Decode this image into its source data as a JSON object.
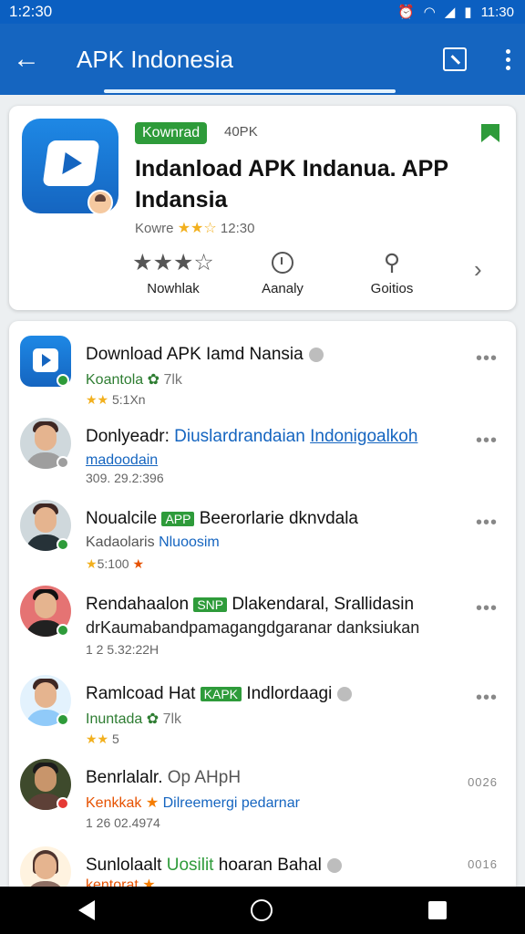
{
  "status": {
    "time_left": "1:2:30",
    "time_right": "11:30"
  },
  "appbar": {
    "title": "APK Indonesia"
  },
  "hero": {
    "badge": "Kownrad",
    "badge_sub": "40PK",
    "title": "Indanload APK Indanua. APP Indansia",
    "meta_label": "Kowre",
    "meta_stars": "★★☆",
    "meta_count": "12:30",
    "stats": [
      {
        "top": "★★★☆",
        "label": "Nowhlak"
      },
      {
        "top": "",
        "label": "Aanaly"
      },
      {
        "top": "⚲",
        "label": "Goitios"
      }
    ]
  },
  "list": [
    {
      "title": "Download APK Iamd Nansia",
      "sub": "Koantola",
      "sub2": "7lk",
      "meta_stars": "★★",
      "meta": "5:1Xn"
    },
    {
      "title": "Donlyeadr:",
      "title_link": "Diuslardrandaian",
      "title_link2": "Indonigoalkoh",
      "sub": "madoodain",
      "meta": "309. 29.2:396"
    },
    {
      "title": "Noualcile",
      "tag": "APP",
      "title_rest": "Beerorlarie dknvdala",
      "sub": "Kadaolaris",
      "sub_blue": "Nluoosim",
      "meta_stars": "★",
      "meta": "5:100",
      "meta_extra": "★"
    },
    {
      "title": "Rendahaalon",
      "tag": "SNP",
      "title_rest": "Dlakendaral, Srallidasin",
      "sub": "drKaumabandpamagangdgaranar danksiukan",
      "meta": "1 2 5.32:22H"
    },
    {
      "title": "Ramlcoad Hat",
      "tag": "KAPK",
      "title_rest": "Indlordaagi",
      "sub": "Inuntada",
      "sub2": "7lk",
      "meta_stars": "★★",
      "meta": "5"
    },
    {
      "title": "Benrlalalr.",
      "title_rest": "Op AHpH",
      "sub_orange": "Kenkkak",
      "sub_link": "Dilreemergi pedarnar",
      "meta": "1 26 02.4974",
      "more": "0026"
    },
    {
      "title": "Sunlolaalt",
      "title_green": "Uosilit",
      "title_rest": "hoaran Bahal",
      "sub_orange": "kentorat",
      "more": "0016"
    }
  ]
}
